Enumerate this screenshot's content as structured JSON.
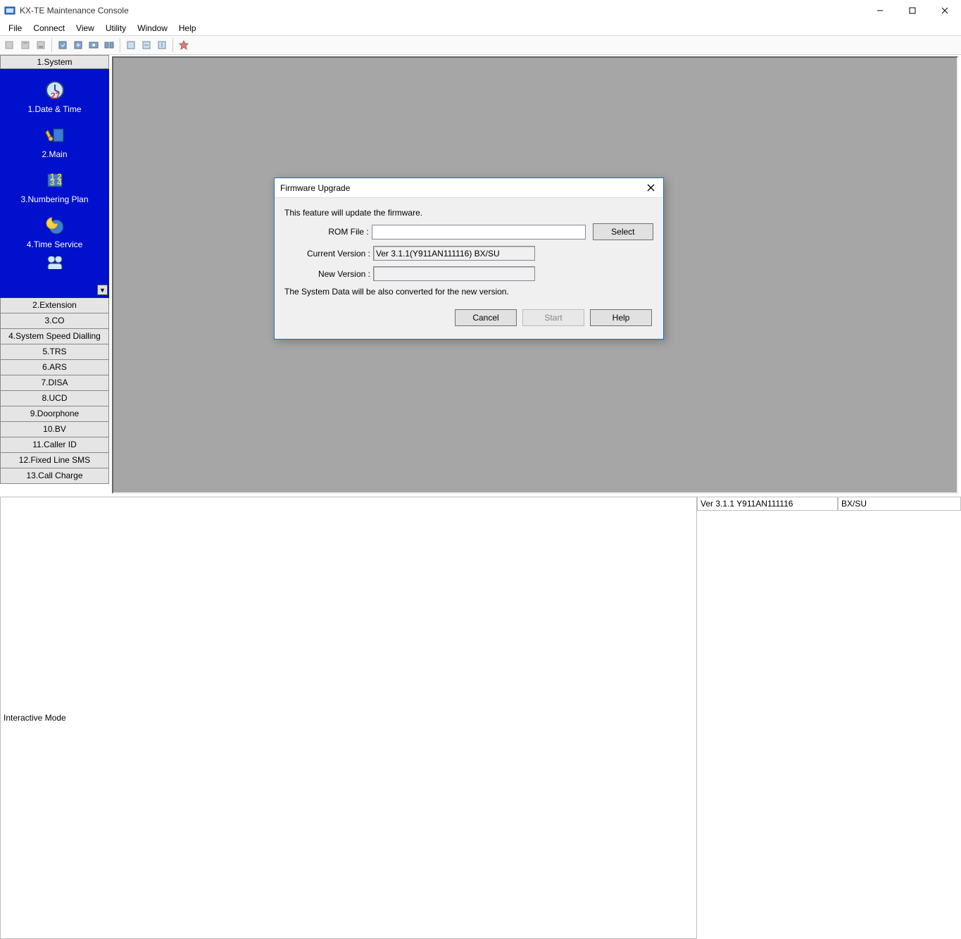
{
  "window": {
    "title": "KX-TE Maintenance Console"
  },
  "menu": {
    "file": "File",
    "connect": "Connect",
    "view": "View",
    "utility": "Utility",
    "window": "Window",
    "help": "Help"
  },
  "sidebar": {
    "header": "1.System",
    "icon_items": [
      {
        "label": "1.Date & Time"
      },
      {
        "label": "2.Main"
      },
      {
        "label": "3.Numbering Plan"
      },
      {
        "label": "4.Time Service"
      }
    ],
    "buttons": [
      "2.Extension",
      "3.CO",
      "4.System Speed Dialling",
      "5.TRS",
      "6.ARS",
      "7.DISA",
      "8.UCD",
      "9.Doorphone",
      "10.BV",
      "11.Caller ID",
      "12.Fixed Line SMS",
      "13.Call Charge"
    ]
  },
  "dialog": {
    "title": "Firmware Upgrade",
    "desc": "This feature will update the firmware.",
    "rom_label": "ROM File :",
    "rom_value": "",
    "select": "Select",
    "cur_label": "Current Version :",
    "cur_value": "Ver 3.1.1(Y911AN111116) BX/SU",
    "new_label": "New Version :",
    "new_value": "",
    "convert_note": "The System Data will be also converted for the new version.",
    "cancel": "Cancel",
    "start": "Start",
    "help": "Help"
  },
  "status": {
    "mode": "Interactive Mode",
    "version": "Ver 3.1.1 Y911AN111116",
    "model": "BX/SU"
  }
}
